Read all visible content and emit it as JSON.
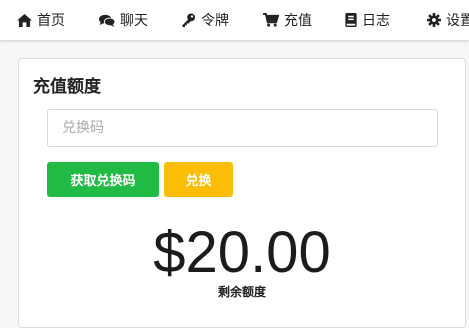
{
  "nav": {
    "items": [
      {
        "label": "首页",
        "icon": "home-icon"
      },
      {
        "label": "聊天",
        "icon": "comments-icon"
      },
      {
        "label": "令牌",
        "icon": "key-icon"
      },
      {
        "label": "充值",
        "icon": "cart-icon"
      },
      {
        "label": "日志",
        "icon": "book-icon"
      },
      {
        "label": "设置",
        "icon": "gear-icon"
      }
    ]
  },
  "topup": {
    "title": "充值额度",
    "code_placeholder": "兑换码",
    "code_value": "",
    "get_code_label": "获取兑换码",
    "redeem_label": "兑换",
    "balance": "$20.00",
    "balance_label": "剩余额度"
  },
  "colors": {
    "green_button": "#21ba45",
    "yellow_button": "#fbbd08",
    "text": "#222222"
  }
}
